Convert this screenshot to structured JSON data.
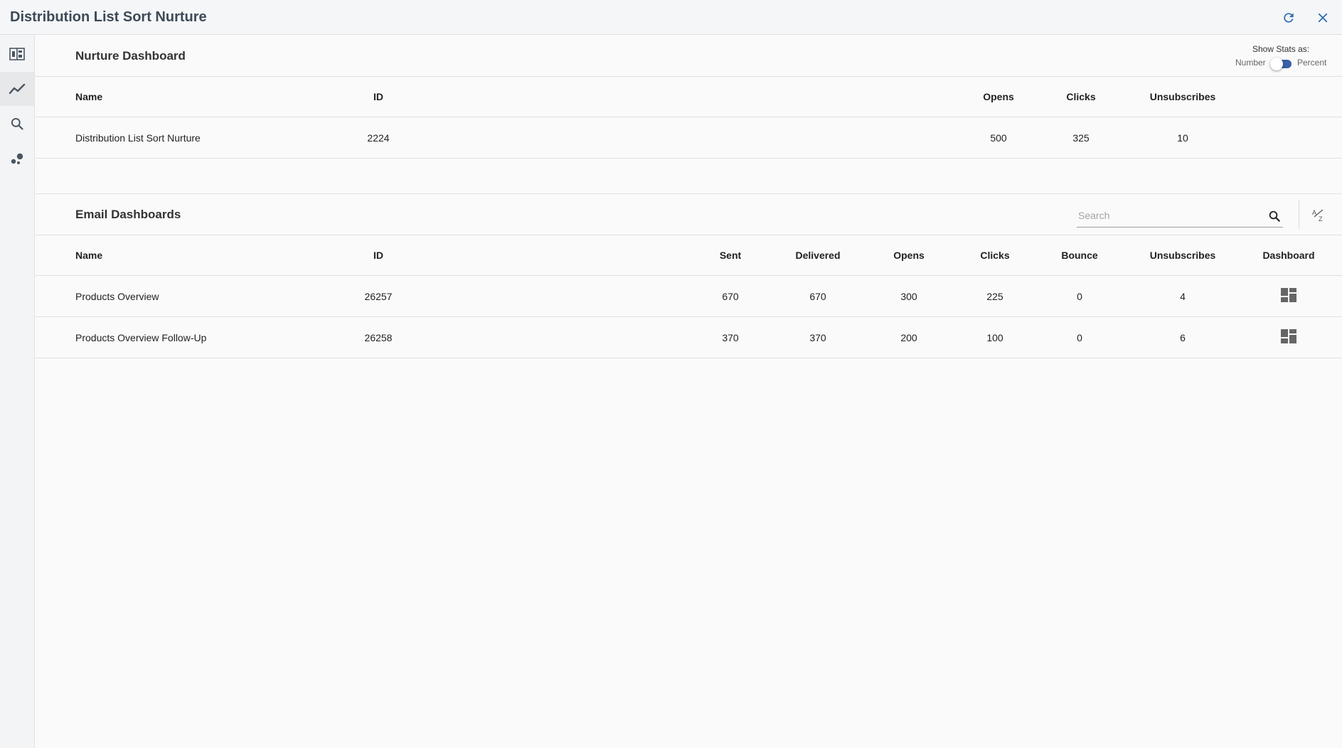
{
  "app": {
    "title": "Distribution List Sort Nurture"
  },
  "icons": {
    "refresh": "refresh-icon",
    "close": "close-icon",
    "sidebar": [
      "dashboard-layout-icon",
      "trend-line-icon",
      "search-icon",
      "scatter-dots-icon"
    ],
    "search": "search-icon",
    "sort": "sort-alpha-icon",
    "dashboard": "dashboard-grid-icon"
  },
  "colors": {
    "accent": "#2a6db0",
    "toggle": "#3a5ea8",
    "icon": "#4a5560"
  },
  "stats_toggle": {
    "label": "Show Stats as:",
    "left": "Number",
    "right": "Percent",
    "selected": "Percent"
  },
  "nurture": {
    "title": "Nurture Dashboard",
    "headers": {
      "name": "Name",
      "id": "ID",
      "opens": "Opens",
      "clicks": "Clicks",
      "unsubscribes": "Unsubscribes"
    },
    "row": {
      "name": "Distribution List Sort Nurture",
      "id": "2224",
      "opens": "500",
      "clicks": "325",
      "unsubscribes": "10"
    }
  },
  "email": {
    "title": "Email Dashboards",
    "search_placeholder": "Search",
    "headers": {
      "name": "Name",
      "id": "ID",
      "sent": "Sent",
      "delivered": "Delivered",
      "opens": "Opens",
      "clicks": "Clicks",
      "bounce": "Bounce",
      "unsubscribes": "Unsubscribes",
      "dashboard": "Dashboard"
    },
    "rows": [
      {
        "name": "Products Overview",
        "id": "26257",
        "sent": "670",
        "delivered": "670",
        "opens": "300",
        "clicks": "225",
        "bounce": "0",
        "unsubscribes": "4"
      },
      {
        "name": "Products Overview Follow-Up",
        "id": "26258",
        "sent": "370",
        "delivered": "370",
        "opens": "200",
        "clicks": "100",
        "bounce": "0",
        "unsubscribes": "6"
      }
    ]
  }
}
